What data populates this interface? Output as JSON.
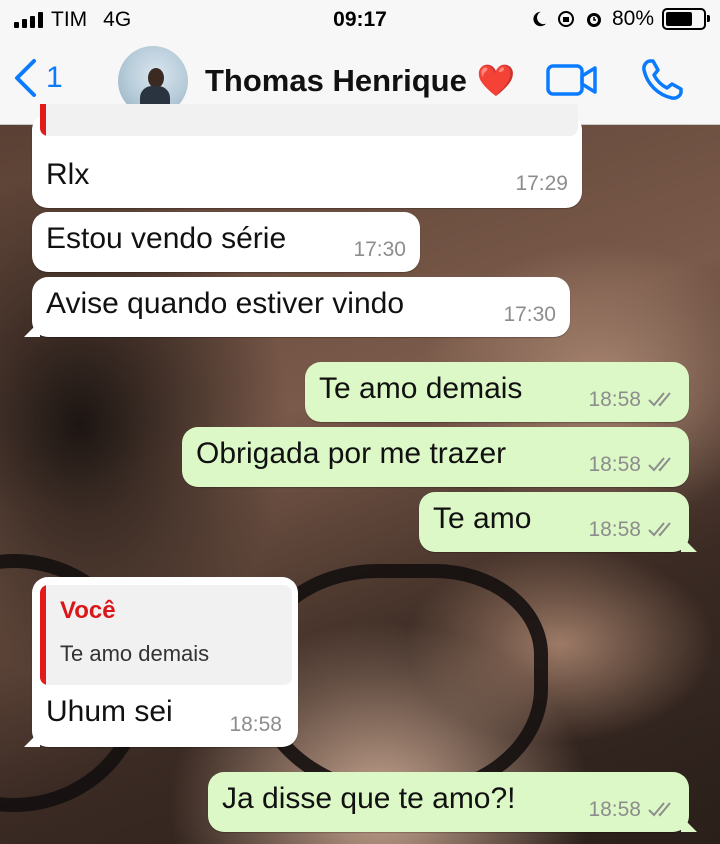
{
  "status_bar": {
    "carrier": "TIM",
    "network": "4G",
    "time": "09:17",
    "battery": "80%",
    "battery_level": 0.8
  },
  "header": {
    "back_count": "1",
    "contact_name": "Thomas Henrique",
    "heart": "❤️",
    "icons": [
      "back-chevron-icon",
      "avatar",
      "video-call-icon",
      "phone-icon"
    ],
    "accent_color": "#0a7bff"
  },
  "messages": [
    {
      "direction": "in",
      "text": "Rlx",
      "time": "17:29"
    },
    {
      "direction": "in",
      "text": "Estou vendo série",
      "time": "17:30"
    },
    {
      "direction": "in",
      "text": "Avise quando estiver vindo",
      "time": "17:30"
    },
    {
      "direction": "out",
      "text": "Te amo demais",
      "time": "18:58",
      "status": "read"
    },
    {
      "direction": "out",
      "text": "Obrigada por me trazer",
      "time": "18:58",
      "status": "read"
    },
    {
      "direction": "out",
      "text": "Te amo",
      "time": "18:58",
      "status": "read"
    },
    {
      "direction": "in",
      "text": "Uhum sei",
      "time": "18:58",
      "reply_to": {
        "author": "Você",
        "text": "Te amo demais"
      }
    },
    {
      "direction": "out",
      "text": "Ja disse que te amo?!",
      "time": "18:58",
      "status": "read"
    }
  ],
  "colors": {
    "incoming_bubble": "#ffffff",
    "outgoing_bubble": "#dcf8c6",
    "reply_author": "#d9161a"
  }
}
